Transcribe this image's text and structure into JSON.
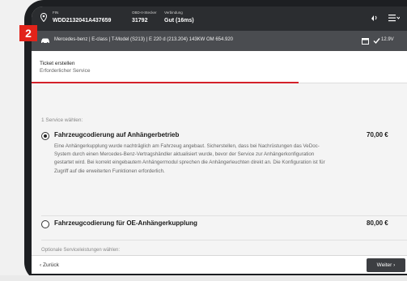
{
  "step_badge": "2",
  "status_bar": {
    "fin_label": "FIN",
    "fin_value": "WDD2132041A437659",
    "obd_label": "OBD-II-Stecker",
    "obd_value": "31792",
    "connection_label": "Verbindung",
    "connection_value": "Gut (16ms)",
    "icons": [
      "location-pin-icon",
      "signal-icon",
      "menu-icon"
    ]
  },
  "vehicle_bar": {
    "vehicle": "Mercedes-benz | E-class | T-Model (S213) | E 220 d (213.204) 143KW OM 654.920",
    "battery": "12.9V",
    "icons": [
      "car-icon",
      "calendar-icon",
      "check-icon"
    ]
  },
  "breadcrumb": {
    "title": "Ticket erstellen",
    "subtitle": "Erforderlicher Service"
  },
  "progress": 0.66,
  "content": {
    "choose_label": "1 Service wählen:",
    "options": [
      {
        "title": "Fahrzeugcodierung auf Anhängerbetrieb",
        "price": "70,00 €",
        "selected": true,
        "description": "Eine Anhängerkupplung wurde nachträglich am Fahrzeug angebaut. Sicherstellen, dass bei Nachrüstungen das VeDoc-System durch einen Mercedes-Benz-Vertragshändler aktualisiert wurde, bevor der Service zur Anhängerkonfiguration gestartet wird. Bei korrekt eingebautem Anhängermodul sprechen die Anhängerleuchten direkt an. Die Konfiguration ist für Zugriff auf die erweiterten Funktionen erforderlich."
      },
      {
        "title": "Fahrzeugcodierung für OE-Anhängerkupplung",
        "price": "80,00 €",
        "selected": false,
        "description": ""
      }
    ],
    "optional_label": "Optionale Serviceleistungen wählen:"
  },
  "footer": {
    "back_label": "‹ Zurück",
    "next_label": "Weiter ›"
  },
  "colors": {
    "accent": "#d4212a",
    "topbar": "#2b2d30",
    "vehiclebar": "#4a4c50",
    "button": "#3c3e42"
  }
}
